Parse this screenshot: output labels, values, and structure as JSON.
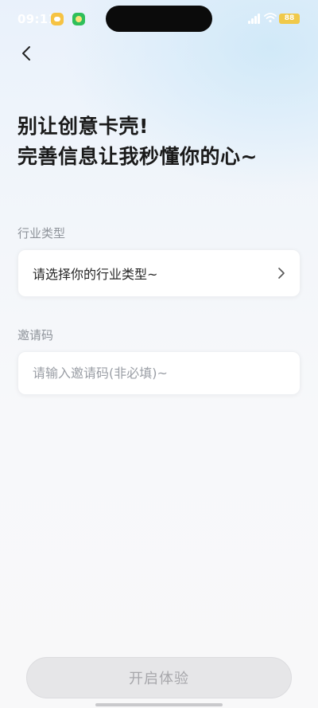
{
  "status_bar": {
    "time": "09:11",
    "battery": "88",
    "icons": [
      "app-notification-icon",
      "app-notification-icon",
      "signal-icon",
      "wifi-icon",
      "battery-icon"
    ]
  },
  "nav": {
    "back_icon": "chevron-left-icon"
  },
  "headline": {
    "line1": "别让创意卡壳!",
    "line2": "完善信息让我秒懂你的心~"
  },
  "industry": {
    "label": "行业类型",
    "placeholder": "请选择你的行业类型~",
    "icon": "chevron-right-icon"
  },
  "invite": {
    "label": "邀请码",
    "placeholder": "请输入邀请码(非必填)~",
    "value": ""
  },
  "footer": {
    "start_label": "开启体验"
  },
  "colors": {
    "text_primary": "#1a1a1a",
    "label_gray": "#8f949b",
    "button_disabled_bg": "#e6e6e8",
    "button_disabled_text": "#a7a7ab"
  }
}
